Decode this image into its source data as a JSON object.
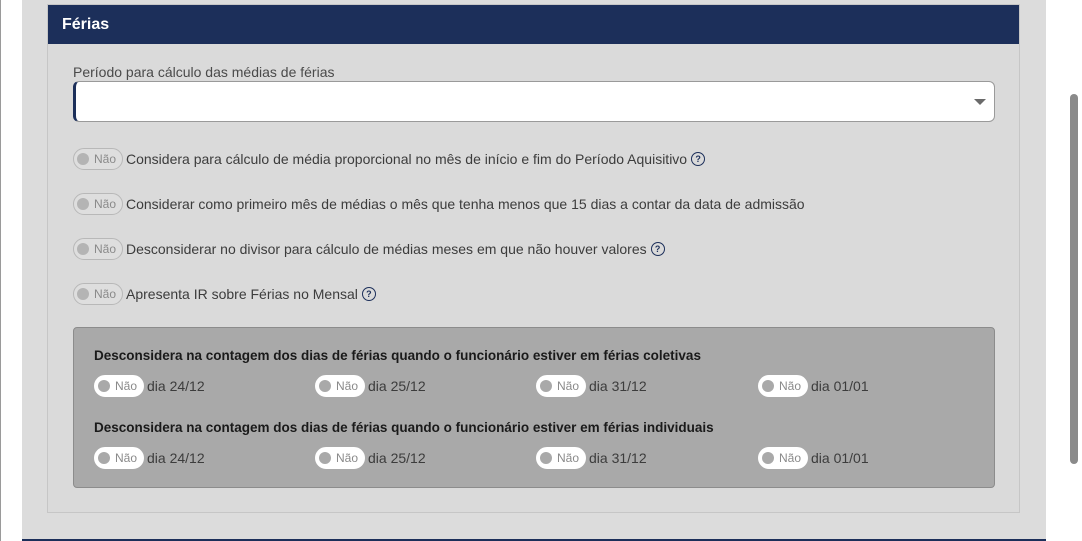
{
  "section": {
    "title": "Férias"
  },
  "period_field": {
    "label": "Período para cálculo das médias de férias",
    "value": ""
  },
  "options": [
    {
      "toggle": "Não",
      "text": "Considera para cálculo de média proporcional no mês de início e fim do Período Aquisitivo",
      "help": "?"
    },
    {
      "toggle": "Não",
      "text": "Considerar como primeiro mês de médias o mês que tenha menos que 15 dias a contar da data de admissão"
    },
    {
      "toggle": "Não",
      "text": "Desconsiderar no divisor para cálculo de médias meses em que não houver valores",
      "help": "?"
    },
    {
      "toggle": "Não",
      "text": "Apresenta IR sobre Férias no Mensal",
      "help": "?"
    }
  ],
  "collective": {
    "title": "Desconsidera na contagem dos dias de férias quando o funcionário estiver em férias coletivas",
    "items": [
      {
        "toggle": "Não",
        "label": "dia 24/12"
      },
      {
        "toggle": "Não",
        "label": "dia 25/12"
      },
      {
        "toggle": "Não",
        "label": "dia 31/12"
      },
      {
        "toggle": "Não",
        "label": "dia 01/01"
      }
    ]
  },
  "individual": {
    "title": "Desconsidera na contagem dos dias de férias quando o funcionário estiver em férias individuais",
    "items": [
      {
        "toggle": "Não",
        "label": "dia 24/12"
      },
      {
        "toggle": "Não",
        "label": "dia 25/12"
      },
      {
        "toggle": "Não",
        "label": "dia 31/12"
      },
      {
        "toggle": "Não",
        "label": "dia 01/01"
      }
    ]
  },
  "colors": {
    "header": "#1c2f5a",
    "panel": "#dadada",
    "gray_box": "#a9a9a9"
  }
}
